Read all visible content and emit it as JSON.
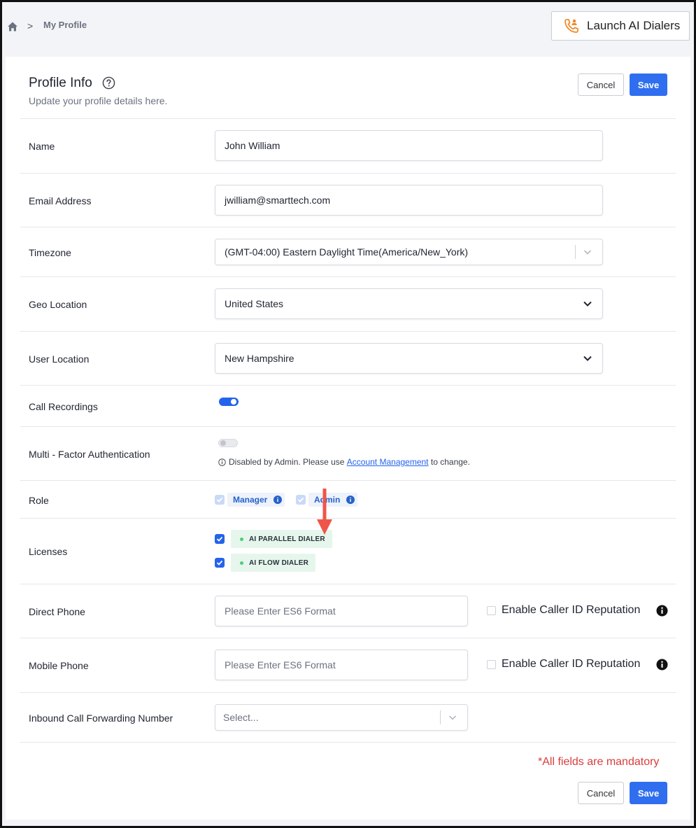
{
  "breadcrumb": {
    "home_icon": "home-icon",
    "separator": ">",
    "current": "My Profile"
  },
  "topbar": {
    "launch_label": "Launch AI Dialers",
    "launch_icon": "phone-user-icon"
  },
  "header": {
    "title": "Profile Info",
    "subtitle": "Update your profile details here.",
    "cancel_label": "Cancel",
    "save_label": "Save"
  },
  "fields": {
    "name": {
      "label": "Name",
      "value": "John William"
    },
    "email": {
      "label": "Email Address",
      "value": "jwilliam@smarttech.com"
    },
    "timezone": {
      "label": "Timezone",
      "value": "(GMT-04:00) Eastern Daylight Time(America/New_York)"
    },
    "geo_location": {
      "label": "Geo Location",
      "value": "United States"
    },
    "user_location": {
      "label": "User Location",
      "value": "New Hampshire"
    },
    "call_recordings": {
      "label": "Call Recordings",
      "enabled": true
    },
    "mfa": {
      "label": "Multi - Factor Authentication",
      "enabled": false,
      "note_prefix": "Disabled by Admin. Please use",
      "note_link": "Account Management",
      "note_suffix": "to change."
    },
    "role": {
      "label": "Role",
      "items": [
        {
          "name": "Manager",
          "checked": true
        },
        {
          "name": "Admin",
          "checked": true
        }
      ]
    },
    "licenses": {
      "label": "Licenses",
      "items": [
        {
          "name": "AI PARALLEL DIALER",
          "checked": true
        },
        {
          "name": "AI FLOW DIALER",
          "checked": true
        }
      ]
    },
    "direct_phone": {
      "label": "Direct Phone",
      "placeholder": "Please Enter ES6 Format",
      "caller_id_label": "Enable Caller ID Reputation"
    },
    "mobile_phone": {
      "label": "Mobile Phone",
      "placeholder": "Please Enter ES6 Format",
      "caller_id_label": "Enable Caller ID Reputation"
    },
    "inbound_forwarding": {
      "label": "Inbound Call Forwarding Number",
      "placeholder": "Select..."
    }
  },
  "footer": {
    "mandatory_note": "*All fields are mandatory",
    "cancel_label": "Cancel",
    "save_label": "Save"
  },
  "colors": {
    "primary": "#2f6fef",
    "toggle_on": "#2463eb",
    "mandatory": "#d93c3c",
    "license_chip": "#e6f6ec",
    "annotation_arrow": "#f0554a"
  }
}
